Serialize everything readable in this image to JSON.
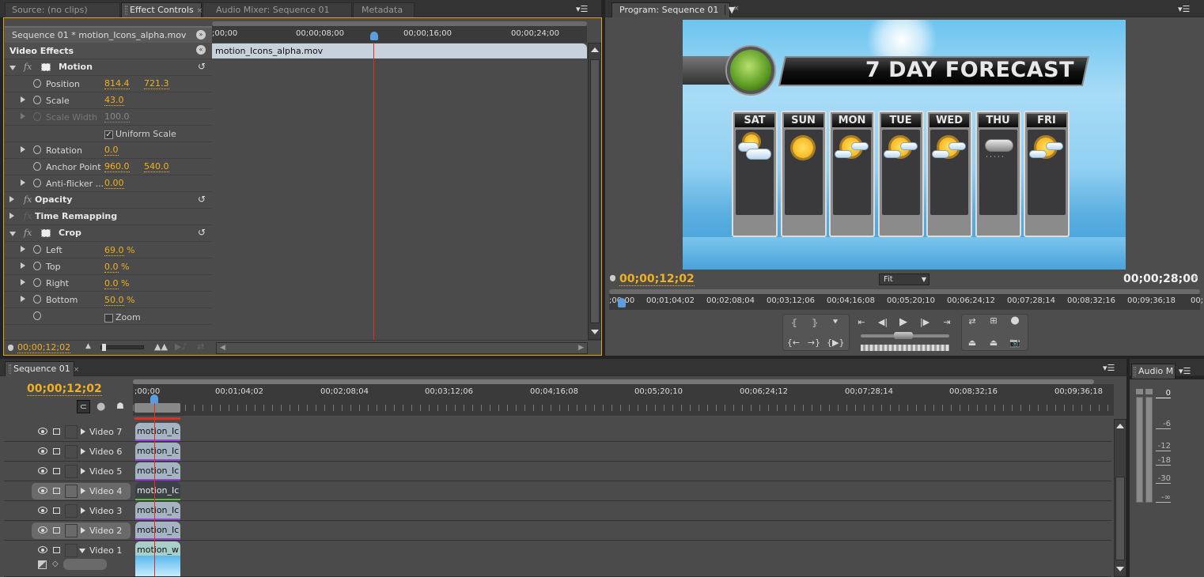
{
  "top_left_panel": {
    "tabs": [
      {
        "label": "Source: (no clips)",
        "active": false
      },
      {
        "label": "Effect Controls",
        "active": true,
        "closable": true
      },
      {
        "label": "Audio Mixer: Sequence 01",
        "active": false
      },
      {
        "label": "Metadata",
        "active": false
      }
    ],
    "clip_header": "Sequence 01 * motion_Icons_alpha.mov",
    "section_title": "Video Effects",
    "clip_bar_label": "motion_Icons_alpha.mov",
    "ruler": [
      ";00;00",
      "00;00;08;00",
      "00;00;16;00",
      "00;00;24;00"
    ],
    "effects": {
      "motion": {
        "name": "Motion",
        "position_label": "Position",
        "position_x": "814.4",
        "position_y": "721.3",
        "scale_label": "Scale",
        "scale": "43.0",
        "scale_width_label": "Scale Width",
        "scale_width": "100.0",
        "uniform_scale_label": "Uniform Scale",
        "uniform_scale_checked": true,
        "rotation_label": "Rotation",
        "rotation": "0.0",
        "anchor_label": "Anchor Point",
        "anchor_x": "960.0",
        "anchor_y": "540.0",
        "antiflicker_label": "Anti-flicker ...",
        "antiflicker": "0.00"
      },
      "opacity": {
        "name": "Opacity"
      },
      "time_remapping": {
        "name": "Time Remapping"
      },
      "crop": {
        "name": "Crop",
        "left_label": "Left",
        "left": "69.0",
        "left_unit": "%",
        "top_label": "Top",
        "top": "0.0",
        "top_unit": "%",
        "right_label": "Right",
        "right": "0.0",
        "right_unit": "%",
        "bottom_label": "Bottom",
        "bottom": "50.0",
        "bottom_unit": "%",
        "zoom_label": "Zoom",
        "zoom_checked": false
      }
    },
    "timecode": "00;00;12;02"
  },
  "program_monitor": {
    "tab_label": "Program: Sequence 01",
    "current_timecode": "00;00;12;02",
    "duration": "00;00;28;00",
    "fit_label": "Fit",
    "ruler": [
      ";00;00",
      "00;01;04;02",
      "00;02;08;04",
      "00;03;12;06",
      "00;04;16;08",
      "00;05;20;10",
      "00;06;24;12",
      "00;07;28;14",
      "00;08;32;16",
      "00;09;36;18",
      "00;"
    ],
    "video_frame": {
      "title": "7 DAY FORECAST",
      "days": [
        {
          "day": "SAT",
          "icon": "partly-cloudy-icon"
        },
        {
          "day": "SUN",
          "icon": "sunny-icon"
        },
        {
          "day": "MON",
          "icon": "partly-sunny-icon"
        },
        {
          "day": "TUE",
          "icon": "partly-sunny-icon"
        },
        {
          "day": "WED",
          "icon": "partly-sunny-icon"
        },
        {
          "day": "THU",
          "icon": "rain-icon"
        },
        {
          "day": "FRI",
          "icon": "partly-sunny-icon"
        }
      ]
    },
    "transport": {
      "row1": [
        "mark-in",
        "mark-out",
        "add-marker",
        "go-to-in",
        "step-back",
        "play",
        "step-forward",
        "go-to-out",
        "loop",
        "safe-margins",
        "output"
      ],
      "row2": [
        "go-to-prev-edit",
        "go-to-next-edit",
        "play-in-to-out",
        "lift",
        "extract",
        "export-frame"
      ]
    }
  },
  "timeline": {
    "tab_label": "Sequence 01",
    "timecode": "00;00;12;02",
    "ruler": [
      ";00;00",
      "00;01;04;02",
      "00;02;08;04",
      "00;03;12;06",
      "00;04;16;08",
      "00;05;20;10",
      "00;06;24;12",
      "00;07;28;14",
      "00;08;32;16",
      "00;09;36;18"
    ],
    "tracks": [
      {
        "name": "Video 7",
        "clip": "motion_Ic",
        "selected": false
      },
      {
        "name": "Video 6",
        "clip": "motion_Ic",
        "selected": false
      },
      {
        "name": "Video 5",
        "clip": "motion_Ic",
        "selected": false
      },
      {
        "name": "Video 4",
        "clip": "motion_Ic",
        "selected": true
      },
      {
        "name": "Video 3",
        "clip": "motion_Ic",
        "selected": false
      },
      {
        "name": "Video 2",
        "clip": "motion_Ic",
        "selected": true
      },
      {
        "name": "Video 1",
        "clip": "motion_w",
        "selected": false,
        "expanded": true
      }
    ]
  },
  "audio_meters": {
    "tab_label": "Audio M",
    "scale": [
      "0",
      "-6",
      "-12",
      "-18",
      "-30",
      "-∞"
    ]
  },
  "colors": {
    "accent": "#f0b020",
    "playhead": "#e03020",
    "panel_bg": "#4b4b4b",
    "clip": "#a5b4c3"
  }
}
